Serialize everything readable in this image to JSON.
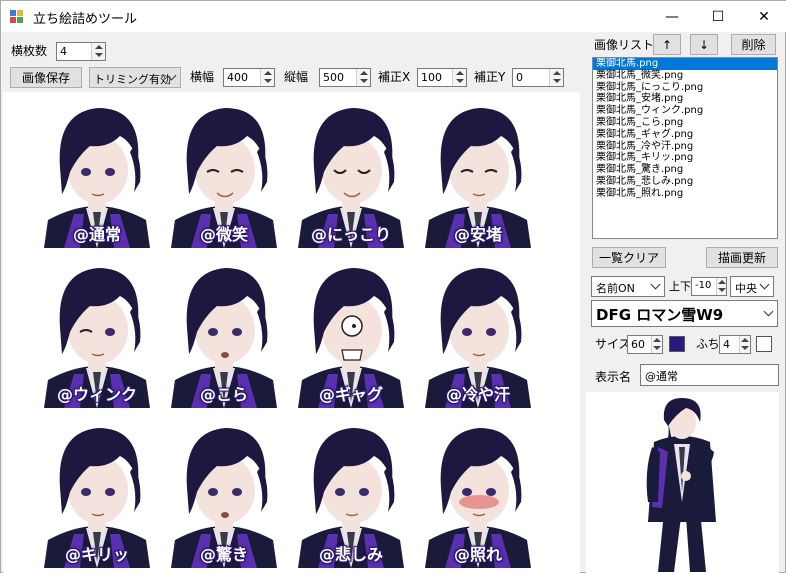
{
  "window": {
    "title": "立ち絵詰めツール",
    "min_glyph": "—",
    "max_glyph": "☐",
    "close_glyph": "✕"
  },
  "toolbar": {
    "columns_label": "横枚数",
    "columns_value": "4",
    "save_label": "画像保存",
    "trim_value": "トリミング有効",
    "width_label": "横幅",
    "width_value": "400",
    "height_label": "縦幅",
    "height_value": "500",
    "offset_x_label": "補正X",
    "offset_x_value": "100",
    "offset_y_label": "補正Y",
    "offset_y_value": "0"
  },
  "image_list": {
    "label": "画像リスト",
    "up_glyph": "↑",
    "down_glyph": "↓",
    "delete_label": "削除",
    "items": [
      "栗御北馬.png",
      "栗御北馬_微笑.png",
      "栗御北馬_にっこり.png",
      "栗御北馬_安堵.png",
      "栗御北馬_ウィンク.png",
      "栗御北馬_こら.png",
      "栗御北馬_ギャグ.png",
      "栗御北馬_冷や汗.png",
      "栗御北馬_キリッ.png",
      "栗御北馬_驚き.png",
      "栗御北馬_悲しみ.png",
      "栗御北馬_照れ.png"
    ],
    "selected_index": 0,
    "clear_label": "一覧クリア",
    "refresh_label": "描画更新"
  },
  "name_settings": {
    "name_mode": "名前ON",
    "vertical_label": "上下",
    "vertical_value": "-10",
    "align_value": "中央",
    "font_value": "DFG ロマン雪W9",
    "size_label": "サイズ",
    "size_value": "60",
    "size_color": "#2a1a7a",
    "border_label": "ふち",
    "border_value": "4",
    "border_color": "#ffffff",
    "display_name_label": "表示名",
    "display_name_value": "@通常"
  },
  "thumbnails": [
    {
      "caption": "@通常",
      "expression": "neutral"
    },
    {
      "caption": "@微笑",
      "expression": "smile"
    },
    {
      "caption": "@にっこり",
      "expression": "grin"
    },
    {
      "caption": "@安堵",
      "expression": "relief"
    },
    {
      "caption": "@ウィンク",
      "expression": "wink"
    },
    {
      "caption": "@こら",
      "expression": "scold"
    },
    {
      "caption": "@ギャグ",
      "expression": "gag"
    },
    {
      "caption": "@冷や汗",
      "expression": "sweat"
    },
    {
      "caption": "@キリッ",
      "expression": "serious"
    },
    {
      "caption": "@驚き",
      "expression": "surprise"
    },
    {
      "caption": "@悲しみ",
      "expression": "sad"
    },
    {
      "caption": "@照れ",
      "expression": "blush"
    }
  ],
  "colors": {
    "hair": "#1e1740",
    "suit": "#1a1a3a",
    "accent": "#5a2fb0",
    "skin": "#f3e3dc",
    "select": "#0078d7"
  }
}
